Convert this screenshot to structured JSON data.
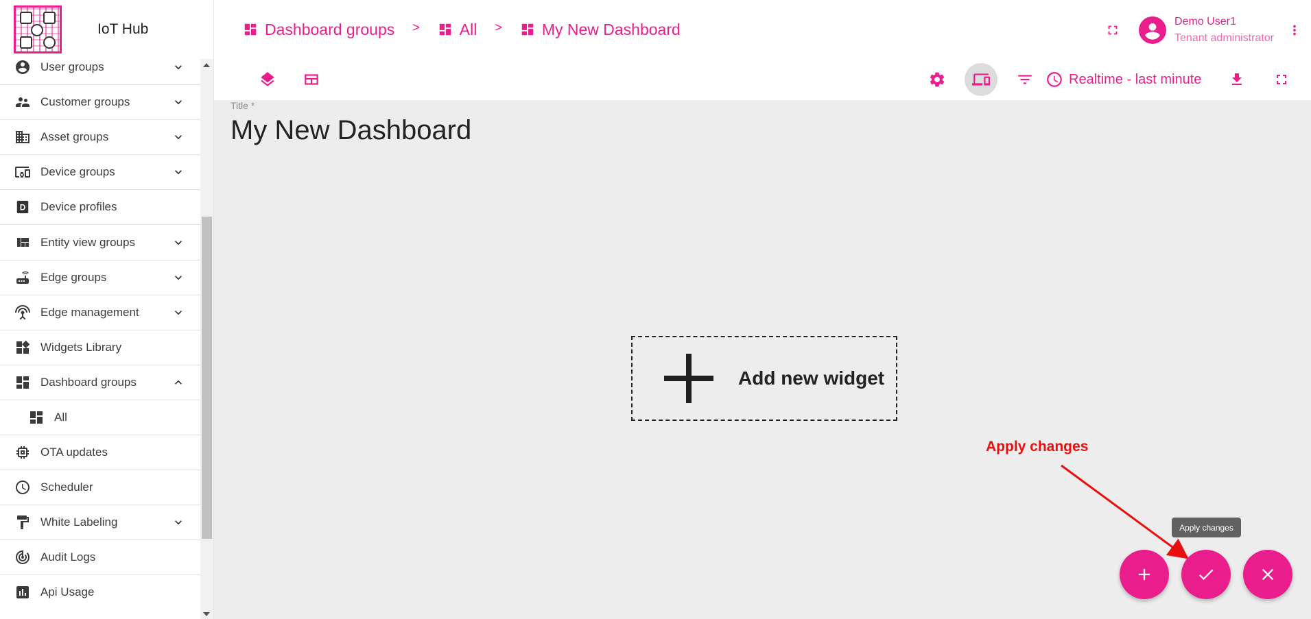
{
  "app": {
    "title": "IoT Hub",
    "accent": "#e91e8c"
  },
  "sidebar": {
    "items": [
      {
        "label": "User groups",
        "icon": "account-circle-icon",
        "expandable": true,
        "expanded": false
      },
      {
        "label": "Customer groups",
        "icon": "supervisor-account-icon",
        "expandable": true,
        "expanded": false
      },
      {
        "label": "Asset groups",
        "icon": "domain-icon",
        "expandable": true,
        "expanded": false
      },
      {
        "label": "Device groups",
        "icon": "devices-other-icon",
        "expandable": true,
        "expanded": false
      },
      {
        "label": "Device profiles",
        "icon": "device-profile-icon",
        "expandable": false
      },
      {
        "label": "Entity view groups",
        "icon": "view-quilt-icon",
        "expandable": true,
        "expanded": false
      },
      {
        "label": "Edge groups",
        "icon": "router-icon",
        "expandable": true,
        "expanded": false
      },
      {
        "label": "Edge management",
        "icon": "settings-input-antenna-icon",
        "expandable": true,
        "expanded": false
      },
      {
        "label": "Widgets Library",
        "icon": "widgets-icon",
        "expandable": false
      },
      {
        "label": "Dashboard groups",
        "icon": "dashboard-icon",
        "expandable": true,
        "expanded": true
      },
      {
        "label": "All",
        "icon": "dashboard-icon",
        "sub": true
      },
      {
        "label": "OTA updates",
        "icon": "memory-icon",
        "expandable": false
      },
      {
        "label": "Scheduler",
        "icon": "schedule-icon",
        "expandable": false
      },
      {
        "label": "White Labeling",
        "icon": "format-paint-icon",
        "expandable": true,
        "expanded": false
      },
      {
        "label": "Audit Logs",
        "icon": "track-changes-icon",
        "expandable": false
      },
      {
        "label": "Api Usage",
        "icon": "insert-chart-icon",
        "expandable": false
      }
    ]
  },
  "breadcrumb": {
    "items": [
      {
        "label": "Dashboard groups",
        "icon": "dashboard-icon"
      },
      {
        "label": "All",
        "icon": "dashboard-icon"
      },
      {
        "label": "My New Dashboard",
        "icon": "dashboard-icon"
      }
    ],
    "separator": ">"
  },
  "user": {
    "name": "Demo User1",
    "role": "Tenant administrator"
  },
  "toolbar": {
    "time_window_label": "Realtime - last minute"
  },
  "dashboard": {
    "title_field_label": "Title *",
    "title": "My New Dashboard",
    "add_widget_label": "Add new widget"
  },
  "annotation": {
    "text": "Apply changes",
    "color": "#e8100f"
  },
  "tooltip": {
    "text": "Apply changes"
  }
}
